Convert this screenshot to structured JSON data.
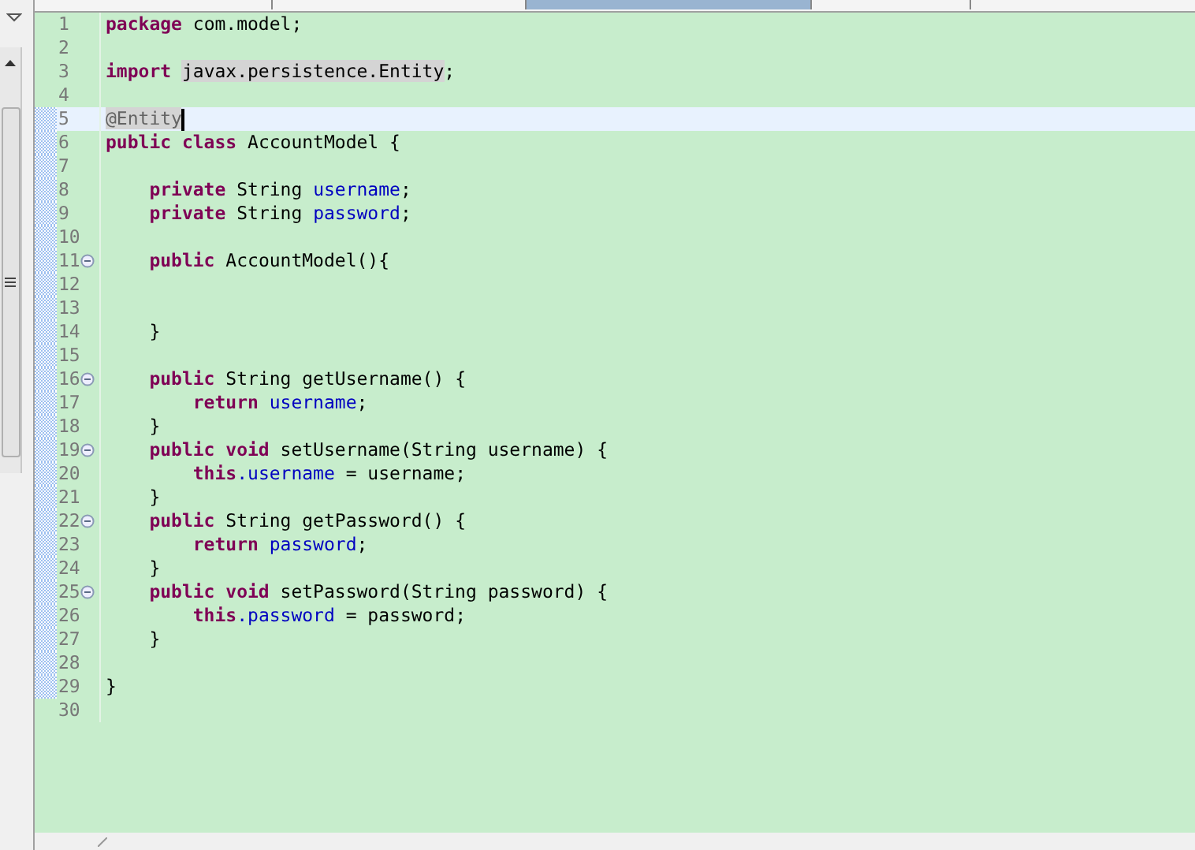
{
  "editor": {
    "lines": [
      {
        "number": "1",
        "changed": false,
        "tokens": [
          {
            "kind": "keyword",
            "text": "package"
          },
          {
            "kind": "plain",
            "text": " com.model;"
          }
        ]
      },
      {
        "number": "2",
        "changed": false
      },
      {
        "number": "3",
        "changed": false,
        "tokens": [
          {
            "kind": "keyword",
            "text": "import "
          },
          {
            "kind": "occurrence",
            "text": "javax.persistence.Entity"
          },
          {
            "kind": "plain",
            "text": ";"
          }
        ]
      },
      {
        "number": "4",
        "changed": false
      },
      {
        "number": "5",
        "current": true,
        "changed": true,
        "tokens": [
          {
            "kind": "annotation",
            "text": "@Entity"
          }
        ]
      },
      {
        "number": "6",
        "changed": true,
        "tokens": [
          {
            "kind": "keyword",
            "text": "public class"
          },
          {
            "kind": "plain",
            "text": " AccountModel {"
          }
        ]
      },
      {
        "number": "7",
        "changed": true
      },
      {
        "number": "8",
        "changed": true,
        "tokens": [
          {
            "kind": "keyword",
            "text": "    private"
          },
          {
            "kind": "plain",
            "text": " String "
          },
          {
            "kind": "field",
            "text": "username"
          },
          {
            "kind": "plain",
            "text": ";"
          }
        ]
      },
      {
        "number": "9",
        "changed": true,
        "tokens": [
          {
            "kind": "keyword",
            "text": "    private"
          },
          {
            "kind": "plain",
            "text": " String "
          },
          {
            "kind": "field",
            "text": "password"
          },
          {
            "kind": "plain",
            "text": ";"
          }
        ]
      },
      {
        "number": "10",
        "changed": true
      },
      {
        "number": "11",
        "foldable": true,
        "changed": true,
        "tokens": [
          {
            "kind": "keyword",
            "text": "    public"
          },
          {
            "kind": "plain",
            "text": " AccountModel(){"
          }
        ]
      },
      {
        "number": "12",
        "changed": true
      },
      {
        "number": "13",
        "changed": true
      },
      {
        "number": "14",
        "changed": true,
        "tokens": [
          {
            "kind": "plain",
            "text": "    }"
          }
        ]
      },
      {
        "number": "15",
        "changed": true
      },
      {
        "number": "16",
        "foldable": true,
        "changed": true,
        "tokens": [
          {
            "kind": "keyword",
            "text": "    public"
          },
          {
            "kind": "plain",
            "text": " String getUsername() {"
          }
        ]
      },
      {
        "number": "17",
        "changed": true,
        "tokens": [
          {
            "kind": "keyword",
            "text": "        return "
          },
          {
            "kind": "field",
            "text": "username"
          },
          {
            "kind": "plain",
            "text": ";"
          }
        ]
      },
      {
        "number": "18",
        "changed": true,
        "tokens": [
          {
            "kind": "plain",
            "text": "    }"
          }
        ]
      },
      {
        "number": "19",
        "foldable": true,
        "changed": true,
        "tokens": [
          {
            "kind": "keyword",
            "text": "    public void"
          },
          {
            "kind": "plain",
            "text": " setUsername(String username) {"
          }
        ]
      },
      {
        "number": "20",
        "changed": true,
        "tokens": [
          {
            "kind": "keyword",
            "text": "        this"
          },
          {
            "kind": "field",
            "text": ".username"
          },
          {
            "kind": "plain",
            "text": " = username;"
          }
        ]
      },
      {
        "number": "21",
        "changed": true,
        "tokens": [
          {
            "kind": "plain",
            "text": "    }"
          }
        ]
      },
      {
        "number": "22",
        "foldable": true,
        "changed": true,
        "tokens": [
          {
            "kind": "keyword",
            "text": "    public"
          },
          {
            "kind": "plain",
            "text": " String getPassword() {"
          }
        ]
      },
      {
        "number": "23",
        "changed": true,
        "tokens": [
          {
            "kind": "keyword",
            "text": "        return "
          },
          {
            "kind": "field",
            "text": "password"
          },
          {
            "kind": "plain",
            "text": ";"
          }
        ]
      },
      {
        "number": "24",
        "changed": true,
        "tokens": [
          {
            "kind": "plain",
            "text": "    }"
          }
        ]
      },
      {
        "number": "25",
        "foldable": true,
        "changed": true,
        "tokens": [
          {
            "kind": "keyword",
            "text": "    public void"
          },
          {
            "kind": "plain",
            "text": " setPassword(String password) {"
          }
        ]
      },
      {
        "number": "26",
        "changed": true,
        "tokens": [
          {
            "kind": "keyword",
            "text": "        this"
          },
          {
            "kind": "field",
            "text": ".password"
          },
          {
            "kind": "plain",
            "text": " = password;"
          }
        ]
      },
      {
        "number": "27",
        "changed": true,
        "tokens": [
          {
            "kind": "plain",
            "text": "    }"
          }
        ]
      },
      {
        "number": "28",
        "changed": true
      },
      {
        "number": "29",
        "changed": true,
        "tokens": [
          {
            "kind": "plain",
            "text": "}"
          }
        ]
      },
      {
        "number": "30",
        "changed": false
      }
    ]
  }
}
